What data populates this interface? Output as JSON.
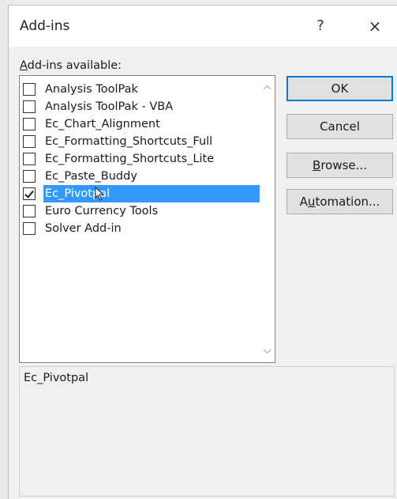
{
  "dialog": {
    "title": "Add-ins",
    "help_label": "?",
    "close_label": "×"
  },
  "list": {
    "label_underlined": "A",
    "label_rest": "dd-ins available:",
    "items": [
      {
        "label": "Analysis ToolPak",
        "checked": false,
        "selected": false
      },
      {
        "label": "Analysis ToolPak - VBA",
        "checked": false,
        "selected": false
      },
      {
        "label": "Ec_Chart_Alignment",
        "checked": false,
        "selected": false
      },
      {
        "label": "Ec_Formatting_Shortcuts_Full",
        "checked": false,
        "selected": false
      },
      {
        "label": "Ec_Formatting_Shortcuts_Lite",
        "checked": false,
        "selected": false
      },
      {
        "label": "Ec_Paste_Buddy",
        "checked": false,
        "selected": false
      },
      {
        "label": "Ec_Pivotpal",
        "checked": true,
        "selected": true
      },
      {
        "label": "Euro Currency Tools",
        "checked": false,
        "selected": false
      },
      {
        "label": "Solver Add-in",
        "checked": false,
        "selected": false
      }
    ]
  },
  "buttons": {
    "ok": "OK",
    "cancel": "Cancel",
    "browse_underlined": "B",
    "browse_rest": "rowse...",
    "automation_pre": "A",
    "automation_underlined": "u",
    "automation_rest": "tomation..."
  },
  "description": {
    "title": "Ec_Pivotpal"
  },
  "colors": {
    "selection": "#3399ff",
    "default_button_border": "#0078d7"
  }
}
